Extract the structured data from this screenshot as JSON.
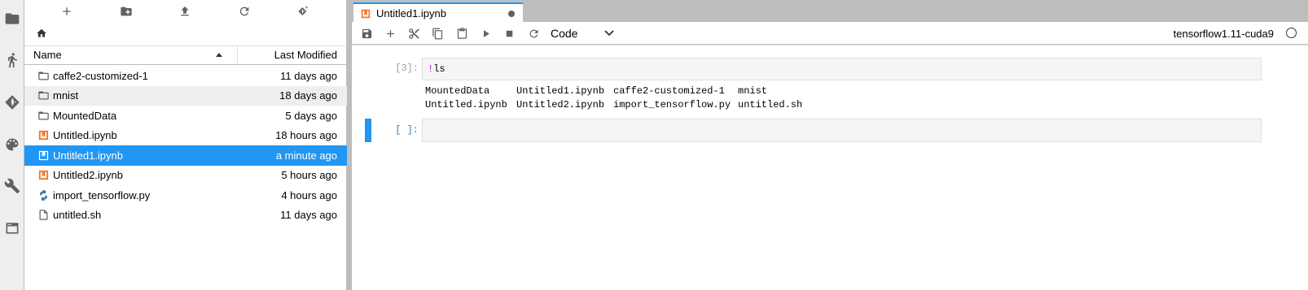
{
  "activity_bar": {
    "icons": [
      "folder-icon",
      "running-icon",
      "git-icon",
      "palette-icon",
      "wrench-icon",
      "tabs-icon"
    ]
  },
  "file_browser": {
    "columns": {
      "name": "Name",
      "modified": "Last Modified"
    },
    "rows": [
      {
        "icon": "folder-icon",
        "name": "caffe2-customized-1",
        "modified": "11 days ago"
      },
      {
        "icon": "folder-icon",
        "name": "mnist",
        "modified": "18 days ago"
      },
      {
        "icon": "folder-icon",
        "name": "MountedData",
        "modified": "5 days ago"
      },
      {
        "icon": "notebook-icon",
        "name": "Untitled.ipynb",
        "modified": "18 hours ago"
      },
      {
        "icon": "notebook-icon",
        "name": "Untitled1.ipynb",
        "modified": "a minute ago"
      },
      {
        "icon": "notebook-icon",
        "name": "Untitled2.ipynb",
        "modified": "5 hours ago"
      },
      {
        "icon": "python-icon",
        "name": "import_tensorflow.py",
        "modified": "4 hours ago"
      },
      {
        "icon": "file-icon",
        "name": "untitled.sh",
        "modified": "11 days ago"
      }
    ]
  },
  "tab": {
    "label": "Untitled1.ipynb"
  },
  "notebook_toolbar": {
    "cell_type": "Code",
    "kernel_name": "tensorflow1.11-cuda9"
  },
  "cells": [
    {
      "prompt": "[3]:",
      "bang": "!",
      "code": "ls",
      "output": [
        [
          "MountedData",
          "Untitled1.ipynb",
          "caffe2-customized-1",
          "mnist"
        ],
        [
          "Untitled.ipynb",
          "Untitled2.ipynb",
          "import_tensorflow.py",
          "untitled.sh"
        ]
      ]
    },
    {
      "prompt": "[ ]:",
      "code": ""
    }
  ],
  "colors": {
    "accent": "#2196f3",
    "notebook_orange": "#f37726",
    "python_blue": "#3572a5"
  }
}
